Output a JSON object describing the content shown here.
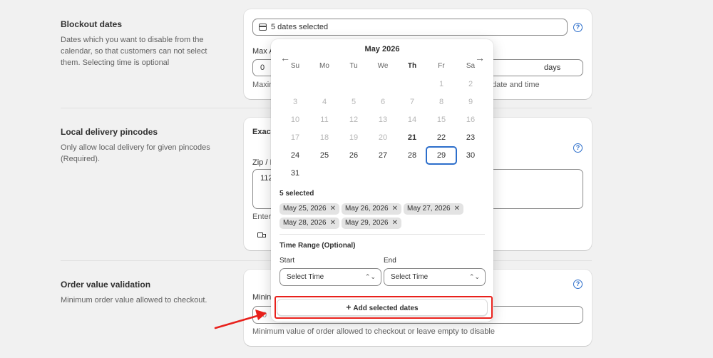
{
  "sections": {
    "blockout": {
      "title": "Blockout dates",
      "description": "Dates which you want to disable from the calendar, so that customers can not select them. Selecting time is optional",
      "dates_field_value": "5 dates selected",
      "max_label": "Max A",
      "max_value": "0",
      "days_suffix": "days",
      "hint_start": "Maxim",
      "hint_end": "date and time"
    },
    "pincodes": {
      "title": "Local delivery pincodes",
      "description": "Only allow local delivery for given pincodes (Required).",
      "exact_label": "Exac",
      "zip_label": "Zip / I",
      "zip_value": "112",
      "hint": "Enter"
    },
    "order_value": {
      "title": "Order value validation",
      "description": "Minimum order value allowed to checkout.",
      "min_label": "Minin",
      "min_value": "0",
      "hint": "Minimum value of order allowed to checkout or leave empty to disable"
    }
  },
  "calendar": {
    "month_label": "May 2026",
    "weekdays": [
      "Su",
      "Mo",
      "Tu",
      "We",
      "Th",
      "Fr",
      "Sa"
    ],
    "today": 21,
    "first_selectable": 21,
    "focused_day": 29,
    "days_in_month": 31,
    "start_weekday_index": 5,
    "selected_count_label": "5 selected",
    "selected_chips": [
      "May 25, 2026",
      "May 26, 2026",
      "May 27, 2026",
      "May 28, 2026",
      "May 29, 2026"
    ],
    "time_range_label": "Time Range (Optional)",
    "start_label": "Start",
    "end_label": "End",
    "start_placeholder": "Select Time",
    "end_placeholder": "Select Time",
    "add_button_label": "Add selected dates"
  },
  "colors": {
    "accent": "#2c6ecb",
    "annotation": "#e8211c"
  }
}
